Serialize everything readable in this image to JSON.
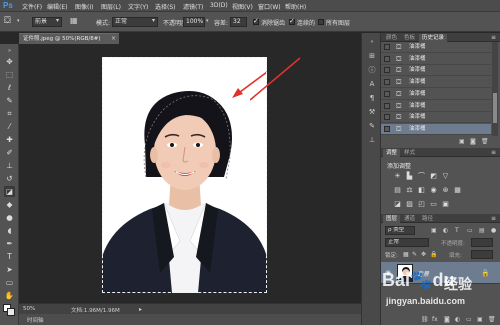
{
  "app": {
    "logo": "Ps",
    "menu": [
      "文件(F)",
      "编辑(E)",
      "图像(I)",
      "图层(L)",
      "文字(Y)",
      "选择(S)",
      "滤镜(T)",
      "3D(D)",
      "视图(V)",
      "窗口(W)",
      "帮助(H)"
    ]
  },
  "options": {
    "preset_value": "前景",
    "mode_label": "模式:",
    "mode_value": "正常",
    "opacity_label": "不透明度:",
    "opacity_value": "100%",
    "tolerance_label": "容差:",
    "tolerance_value": "32",
    "antialias_label": "消除锯齿",
    "contiguous_label": "连续的",
    "all_layers_label": "所有图层",
    "antialias_checked": true,
    "contiguous_checked": true,
    "all_layers_checked": false
  },
  "document": {
    "tab_title": "证件照.jpeg @ 50%(RGB/8#)",
    "close_glyph": "×",
    "zoom": "50%",
    "doc_info": "文档:1.96M/1.96M"
  },
  "status": {
    "timeline_label": "时间轴"
  },
  "panels": {
    "history": {
      "tabs": [
        "颜色",
        "色板",
        "历史记录"
      ],
      "active_tab": "历史记录",
      "rows": [
        "油漆桶",
        "油漆桶",
        "油漆桶",
        "油漆桶",
        "油漆桶",
        "油漆桶",
        "油漆桶",
        "油漆桶"
      ],
      "selected_index": 7
    },
    "adjustments": {
      "tabs": [
        "调整",
        "样式"
      ],
      "title": "添加调整"
    },
    "layers": {
      "tabs": [
        "图层",
        "通道",
        "路径"
      ],
      "filter_value": "ρ 类型",
      "blend_value": "正常",
      "opacity_label": "不透明度:",
      "lock_label": "锁定:",
      "fill_label": "填充:",
      "layer_name": "背景"
    }
  },
  "watermark": {
    "logo": "Bai",
    "logo_accent": "du",
    "cn_text": "经验",
    "url": "jingyan.baidu.com"
  },
  "colors": {
    "arrow": "#e0322c",
    "selection_highlight": "#6d7c8f",
    "ps_blue": "#3fa0ff"
  }
}
